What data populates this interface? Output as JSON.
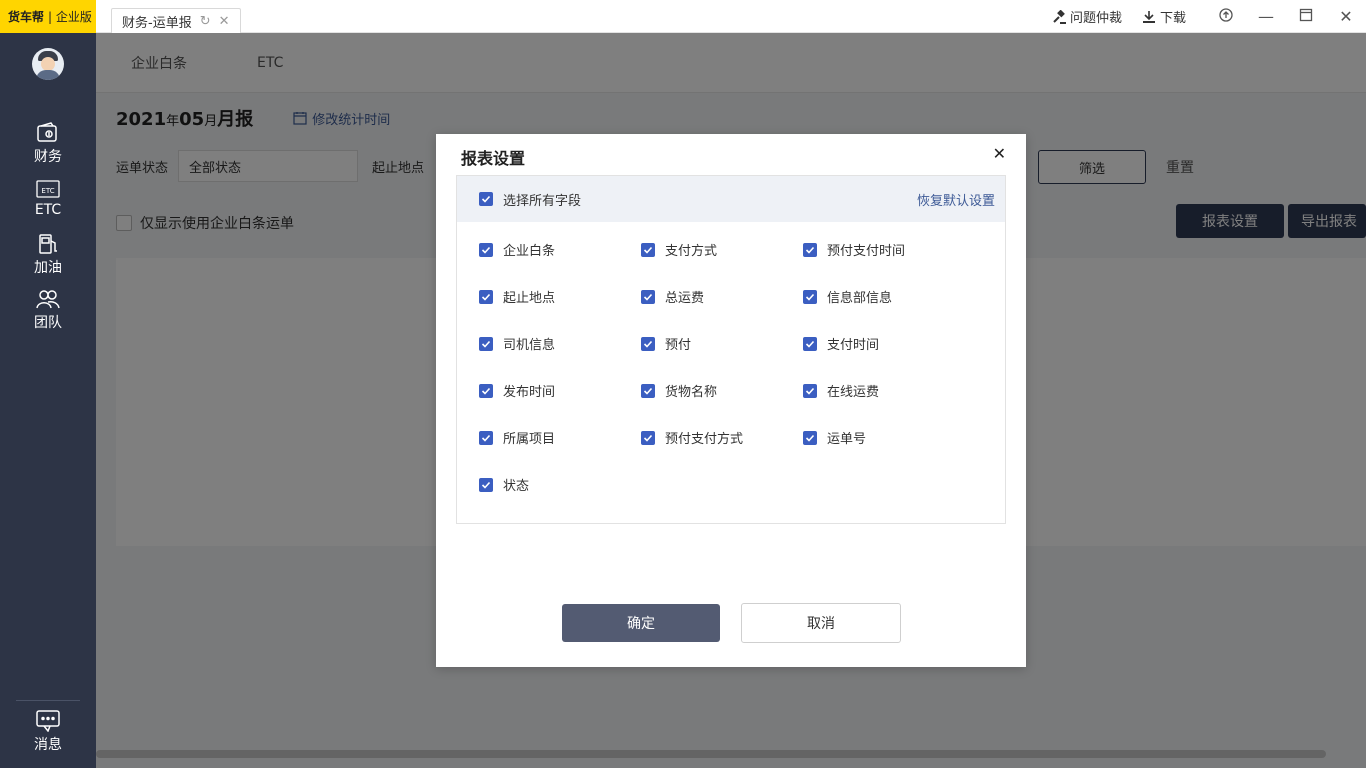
{
  "app": {
    "logo": "货车帮",
    "edition": "企业版"
  },
  "sidebar": {
    "items": [
      {
        "label": "财务",
        "icon": "wallet-icon"
      },
      {
        "label": "ETC",
        "icon": "etc-card-icon"
      },
      {
        "label": "加油",
        "icon": "fuel-pump-icon"
      },
      {
        "label": "团队",
        "icon": "team-icon"
      }
    ],
    "bottom": {
      "label": "消息",
      "icon": "message-icon"
    }
  },
  "topbar": {
    "tab_label": "财务-运单报",
    "dispute_label": "问题仲裁",
    "download_label": "下载"
  },
  "subnav": {
    "items": [
      "企业白条",
      "ETC"
    ]
  },
  "report": {
    "year": "2021",
    "year_unit": "年",
    "month": "05",
    "month_unit": "月",
    "title_suffix": "月报",
    "edit_time_label": "修改统计时间"
  },
  "filters": {
    "status_label": "运单状态",
    "status_value": "全部状态",
    "route_label": "起止地点",
    "filter_button": "筛选",
    "reset_button": "重置",
    "only_baitiao_label": "仅显示使用企业白条运单",
    "report_settings_button": "报表设置",
    "export_button": "导出报表"
  },
  "modal": {
    "title": "报表设置",
    "select_all_label": "选择所有字段",
    "restore_default_label": "恢复默认设置",
    "fields": [
      "企业白条",
      "支付方式",
      "预付支付时间",
      "起止地点",
      "总运费",
      "信息部信息",
      "司机信息",
      "预付",
      "支付时间",
      "发布时间",
      "货物名称",
      "在线运费",
      "所属项目",
      "预付支付方式",
      "运单号",
      "状态"
    ],
    "ok_label": "确定",
    "cancel_label": "取消"
  },
  "colors": {
    "sidebar_bg": "#2d3446",
    "logo_bg": "#ffd500",
    "checkbox": "#3b5ec1",
    "primary_button": "#535b72",
    "link": "#3d5a96"
  }
}
